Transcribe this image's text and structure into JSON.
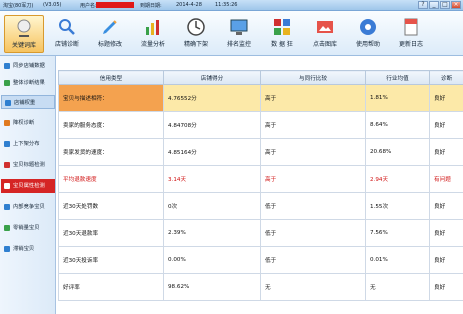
{
  "titlebar": {
    "app": "淘宝(80军刀)",
    "version": "(V3.05)",
    "user_label": "用户名:",
    "expire_label": "到期日期:",
    "date": "2014-4-28",
    "time": "11:35:26",
    "buttons": [
      "?",
      "_",
      "□",
      "×"
    ]
  },
  "toolbar": {
    "items": [
      {
        "label": "关键词库",
        "icon": "keyword-db-icon",
        "active": true
      },
      {
        "label": "店铺诊断",
        "icon": "shop-diagnosis-icon",
        "active": false
      },
      {
        "label": "标题修改",
        "icon": "title-edit-icon",
        "active": false
      },
      {
        "label": "流量分析",
        "icon": "traffic-analysis-icon",
        "active": false
      },
      {
        "label": "精确下架",
        "icon": "precise-delist-icon",
        "active": false
      },
      {
        "label": "排名监控",
        "icon": "rank-monitor-icon",
        "active": false
      },
      {
        "label": "数 据 狂",
        "icon": "data-icon",
        "active": false
      },
      {
        "label": "点击图库",
        "icon": "click-gallery-icon",
        "active": false
      },
      {
        "label": "使用帮助",
        "icon": "help-icon",
        "active": false
      },
      {
        "label": "更新日志",
        "icon": "update-log-icon",
        "active": false
      }
    ]
  },
  "sidebar": {
    "items": [
      {
        "label": "同步店铺数据",
        "color": "#2f7fd0",
        "state": ""
      },
      {
        "label": "整体诊断结果",
        "color": "#3aa14a",
        "state": ""
      },
      {
        "label": "店铺权重",
        "color": "#2f7fd0",
        "state": "hl"
      },
      {
        "label": "降权诊断",
        "color": "#e07a20",
        "state": ""
      },
      {
        "label": "上下架分布",
        "color": "#2f7fd0",
        "state": ""
      },
      {
        "label": "宝贝标题检测",
        "color": "#d03030",
        "state": ""
      },
      {
        "label": "宝贝属性检测",
        "color": "#ffffff",
        "state": "sel"
      },
      {
        "label": "内部竞争宝贝",
        "color": "#2f7fd0",
        "state": ""
      },
      {
        "label": "零销量宝贝",
        "color": "#3aa14a",
        "state": ""
      },
      {
        "label": "滞销宝贝",
        "color": "#2f7fd0",
        "state": ""
      }
    ]
  },
  "table": {
    "headers": [
      "信用类型",
      "店铺得分",
      "与同行比较",
      "行业均值",
      "诊断"
    ],
    "rows": [
      {
        "cells": [
          "宝贝与描述相符：",
          "4.76552分",
          "高于",
          "1.81%",
          "良好"
        ],
        "style": "highlight"
      },
      {
        "cells": [
          "卖家的服务态度：",
          "4.84708分",
          "高于",
          "8.64%",
          "良好"
        ],
        "style": ""
      },
      {
        "cells": [
          "卖家发货的速度：",
          "4.85164分",
          "高于",
          "20.68%",
          "良好"
        ],
        "style": ""
      },
      {
        "cells": [
          "平均退款速度",
          "3.14天",
          "高于",
          "2.94天",
          "有问题"
        ],
        "style": "warn"
      },
      {
        "cells": [
          "近30天处罚数",
          "0次",
          "低于",
          "1.55次",
          "良好"
        ],
        "style": ""
      },
      {
        "cells": [
          "近30天退款率",
          "2.39%",
          "低于",
          "7.56%",
          "良好"
        ],
        "style": ""
      },
      {
        "cells": [
          "近30天投诉率",
          "0.00%",
          "低于",
          "0.01%",
          "良好"
        ],
        "style": ""
      },
      {
        "cells": [
          "好评率",
          "98.62%",
          "无",
          "无",
          "良好"
        ],
        "style": ""
      }
    ]
  }
}
